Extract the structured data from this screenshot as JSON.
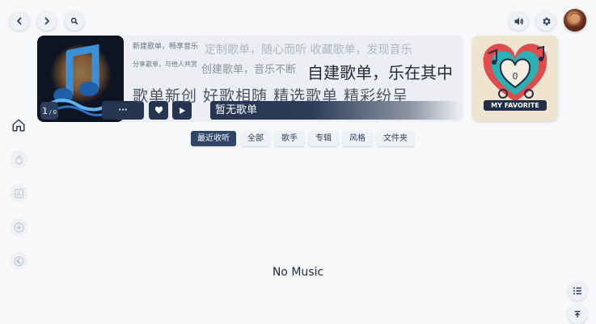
{
  "banner": {
    "count_current": "1",
    "count_total": "0",
    "more_glyph": "···",
    "now_playing": "暂无歌单",
    "lyrics": {
      "line1_small": "新建歌单，畅享音乐",
      "line1_large": "定制歌单，随心而听 收藏歌单，发现音乐",
      "line2_small": "分享歌单，与他人共赏",
      "line2_mid": "创建歌单，音乐不断",
      "line2_large": "自建歌单，乐在其中",
      "line3": "歌单新创  好歌相随 精选歌单  精彩纷呈"
    }
  },
  "favorite": {
    "label": "MY FAVORITE",
    "count": "0"
  },
  "tabs": [
    "最近收听",
    "全部",
    "歌手",
    "专辑",
    "风格",
    "文件夹"
  ],
  "empty_message": "No Music",
  "colors": {
    "accent": "#2f4668",
    "background": "#f7f8fa",
    "card": "#eceef3"
  },
  "icons": {
    "back": "chevron-left-icon",
    "forward": "chevron-right-icon",
    "search": "search-icon",
    "volume": "volume-icon",
    "settings": "gear-icon"
  }
}
